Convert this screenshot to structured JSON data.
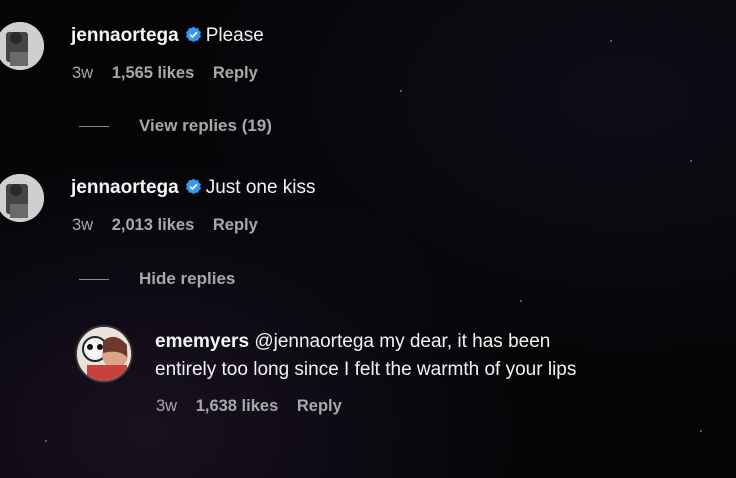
{
  "comments": [
    {
      "username": "jennaortega",
      "text": "Please",
      "age": "3w",
      "likes": "1,565 likes",
      "reply": "Reply",
      "replies_toggle": "View replies (19)"
    },
    {
      "username": "jennaortega",
      "text": "Just one kiss",
      "age": "3w",
      "likes": "2,013 likes",
      "reply": "Reply",
      "replies_toggle": "Hide replies"
    }
  ],
  "reply": {
    "username": "ememyers",
    "text_line1": "@jennaortega my dear, it has been",
    "text_line2": "entirely too long since I felt the warmth of your lips",
    "age": "3w",
    "likes": "1,638 likes",
    "reply": "Reply"
  },
  "colors": {
    "background": "#000000",
    "text_primary": "#f2f2f2",
    "text_secondary": "#a8a8a8",
    "verified_badge": "#3897f0"
  }
}
